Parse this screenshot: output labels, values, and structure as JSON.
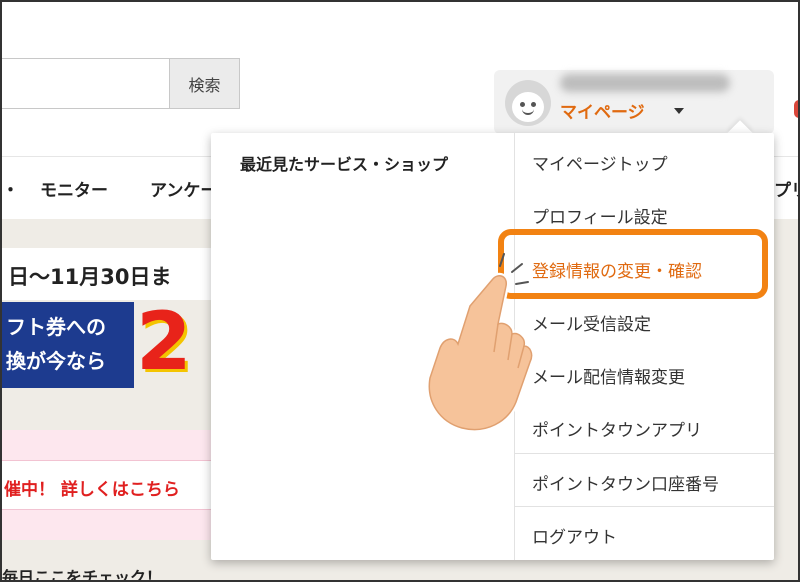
{
  "search": {
    "button_label": "検索"
  },
  "header": {
    "mypage_label": "マイページ"
  },
  "nav": {
    "items": [
      "モニター",
      "アンケー",
      "プリ"
    ]
  },
  "banner": {
    "date_text": "日〜11月30日ま",
    "line1": "フト券への",
    "line2": "換が今なら",
    "big_number": "2"
  },
  "notice": {
    "text": "催中！ 詳しくはこちら"
  },
  "daily": {
    "text": "毎日ここをチェック！"
  },
  "dropdown": {
    "recent_title": "最近見たサービス・ショップ",
    "items": [
      "マイページトップ",
      "プロフィール設定",
      "登録情報の変更・確認",
      "メール受信設定",
      "メール配信情報変更",
      "ポイントタウンアプリ",
      "ポイントタウン口座番号",
      "ログアウト"
    ]
  },
  "colors": {
    "accent": "#e06a10",
    "highlight": "#f28212",
    "banner_blue": "#1d3b8f",
    "banner_red": "#e8231a"
  }
}
